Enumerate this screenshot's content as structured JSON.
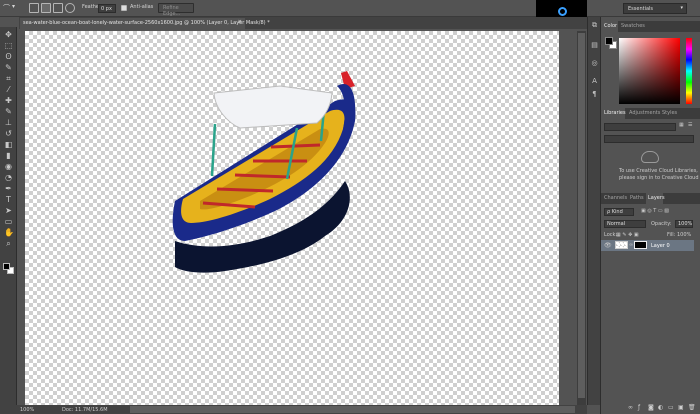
{
  "options_bar": {
    "feather_label": "Feather:",
    "feather_value": "0 px",
    "anti_alias_label": "Anti-alias",
    "refine_edge_label": "Refine Edge..."
  },
  "workspace": {
    "label": "Essentials"
  },
  "document_tab": {
    "title": "sea-water-blue-ocean-boat-lonely-water-surface-2560x1600.jpg @ 100% (Layer 0, Layer Mask/8) *",
    "close": "×"
  },
  "toolbar": {
    "tools": [
      "move-tool",
      "marquee-tool",
      "lasso-tool",
      "quick-select-tool",
      "crop-tool",
      "eyedropper-tool",
      "healing-brush-tool",
      "brush-tool",
      "clone-stamp-tool",
      "history-brush-tool",
      "eraser-tool",
      "gradient-tool",
      "blur-tool",
      "dodge-tool",
      "pen-tool",
      "type-tool",
      "path-select-tool",
      "shape-tool",
      "hand-tool",
      "zoom-tool"
    ],
    "glyphs": [
      "✥",
      "⬚",
      "ʘ",
      "✎",
      "⌗",
      "⁄",
      "✚",
      "✎",
      "⊥",
      "↺",
      "◧",
      "▮",
      "◉",
      "◔",
      "✒",
      "T",
      "➤",
      "▭",
      "✋",
      "⌕"
    ]
  },
  "status_bar": {
    "zoom": "100%",
    "doc_info": "Doc: 11.7M/15.6M"
  },
  "panels": {
    "color": {
      "tabs": [
        "Color",
        "Swatches"
      ],
      "active_tab": "Color",
      "foreground": "#000000",
      "background": "#ffffff"
    },
    "libraries": {
      "tabs": [
        "Libraries",
        "Adjustments",
        "Styles"
      ],
      "active_tab": "Libraries",
      "message_line1": "To use Creative Cloud Libraries,",
      "message_line2": "please sign in to Creative Cloud"
    },
    "layers": {
      "tabs": [
        "Channels",
        "Paths",
        "Layers"
      ],
      "active_tab": "Layers",
      "filter_label": "ρ Kind",
      "blend_mode": "Normal",
      "opacity_label": "Opacity:",
      "opacity_value": "100%",
      "lock_label": "Lock:",
      "fill_label": "Fill:",
      "fill_value": "100%",
      "layers": [
        {
          "name": "Layer 0"
        }
      ]
    }
  }
}
